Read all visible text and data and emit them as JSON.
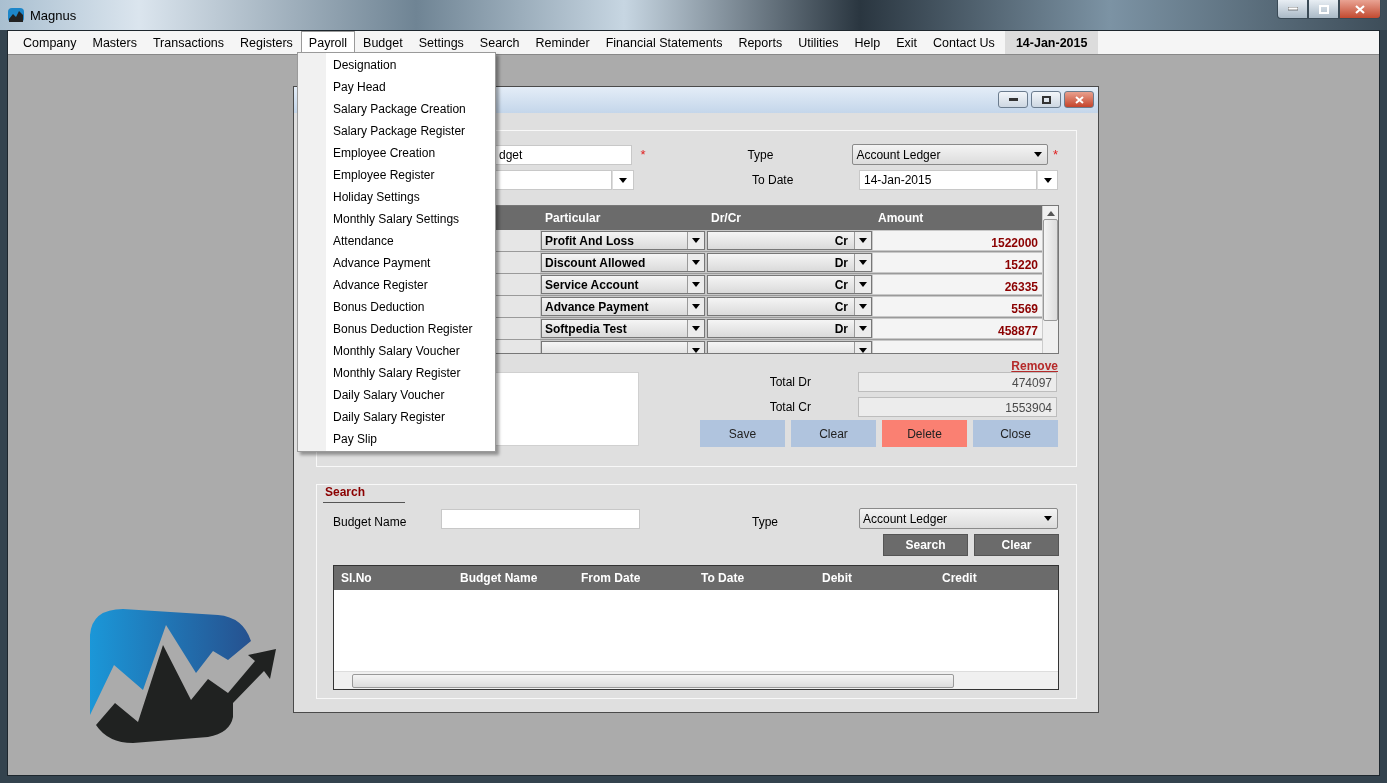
{
  "window": {
    "title": "Magnus"
  },
  "menu_bar": {
    "items": [
      {
        "label": "Company",
        "selected": false
      },
      {
        "label": "Masters",
        "selected": false
      },
      {
        "label": "Transactions",
        "selected": false
      },
      {
        "label": "Registers",
        "selected": false
      },
      {
        "label": "Payroll",
        "selected": true
      },
      {
        "label": "Budget",
        "selected": false
      },
      {
        "label": "Settings",
        "selected": false
      },
      {
        "label": "Search",
        "selected": false
      },
      {
        "label": "Reminder",
        "selected": false
      },
      {
        "label": "Financial Statements",
        "selected": false
      },
      {
        "label": "Reports",
        "selected": false
      },
      {
        "label": "Utilities",
        "selected": false
      },
      {
        "label": "Help",
        "selected": false
      },
      {
        "label": "Exit",
        "selected": false
      },
      {
        "label": "Contact Us",
        "selected": false
      }
    ],
    "date": "14-Jan-2015"
  },
  "payroll_menu": {
    "items": [
      "Designation",
      "Pay Head",
      "Salary Package Creation",
      "Salary Package Register",
      "Employee Creation",
      "Employee Register",
      "Holiday Settings",
      "Monthly Salary Settings",
      "Attendance",
      "Advance Payment",
      "Advance Register",
      "Bonus Deduction",
      "Bonus Deduction Register",
      "Monthly Salary Voucher",
      "Monthly Salary Register",
      "Daily Salary Voucher",
      "Daily Salary Register",
      "Pay Slip"
    ]
  },
  "budget_form": {
    "budget_name": {
      "value": "dget",
      "required_mark": "*"
    },
    "type": {
      "label": "Type",
      "value": "Account Ledger",
      "required_mark": "*"
    },
    "to_date": {
      "label": "To Date",
      "value": "14-Jan-2015"
    },
    "grid": {
      "columns": [
        "Particular",
        "Dr/Cr",
        "Amount"
      ],
      "rows": [
        {
          "kind": "filled",
          "particular": "Profit And Loss",
          "dr_cr": "Cr",
          "amount": "1522000"
        },
        {
          "kind": "filled",
          "particular": "Discount Allowed",
          "dr_cr": "Dr",
          "amount": "15220"
        },
        {
          "kind": "filled",
          "particular": "Service Account",
          "dr_cr": "Cr",
          "amount": "26335"
        },
        {
          "kind": "filled",
          "particular": "Advance Payment",
          "dr_cr": "Cr",
          "amount": "5569"
        },
        {
          "kind": "filled",
          "particular": "Softpedia Test",
          "dr_cr": "Dr",
          "amount": "458877"
        },
        {
          "kind": "blank"
        }
      ]
    },
    "remove_link": "Remove",
    "total_dr": {
      "label": "Total Dr",
      "value": "474097"
    },
    "total_cr": {
      "label": "Total Cr",
      "value": "1553904"
    },
    "buttons": [
      {
        "label": "Save",
        "kind": "normal"
      },
      {
        "label": "Clear",
        "kind": "normal"
      },
      {
        "label": "Delete",
        "kind": "danger"
      },
      {
        "label": "Close",
        "kind": "normal"
      }
    ]
  },
  "search": {
    "title": "Search",
    "budget_name_label": "Budget Name",
    "type_label": "Type",
    "type_value": "Account Ledger",
    "buttons": [
      "Search",
      "Clear"
    ],
    "columns": [
      "Sl.No",
      "Budget Name",
      "From Date",
      "To Date",
      "Debit",
      "Credit"
    ]
  }
}
